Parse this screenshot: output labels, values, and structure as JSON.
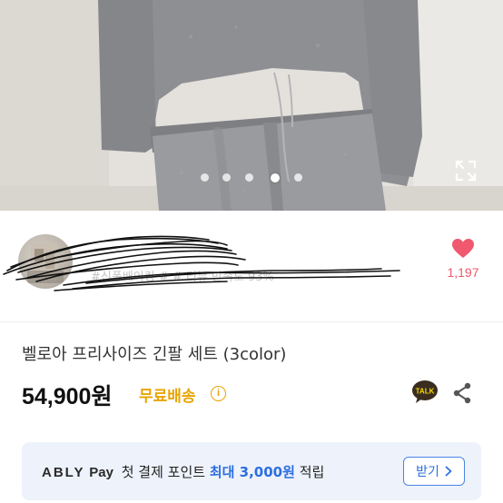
{
  "hero": {
    "slide_count": 5,
    "active_slide_index": 3,
    "expand_icon": "expand-icon"
  },
  "seller": {
    "name": "",
    "meta": "#신퐁배이킹 #  # 리뷰 만족도 93%",
    "like_icon": "heart-icon",
    "like_count": "1,197",
    "heart_color": "#f0586f"
  },
  "product": {
    "title": "벨로아 프리사이즈 긴팔 세트 (3color)",
    "price": "54,900원",
    "shipping_badge": "무료배송",
    "shipping_info_icon": "i",
    "shipping_color": "#e8a400"
  },
  "actions": {
    "talk_label": "TALK",
    "share_icon": "share-icon"
  },
  "banner": {
    "brand": "ABLY",
    "pay": "Pay",
    "text_prefix": "첫 결제 포인트 ",
    "highlight": "최대 3,000원",
    "text_suffix": " 적립",
    "button_label": "받기",
    "accent_color": "#2b6fe0"
  }
}
